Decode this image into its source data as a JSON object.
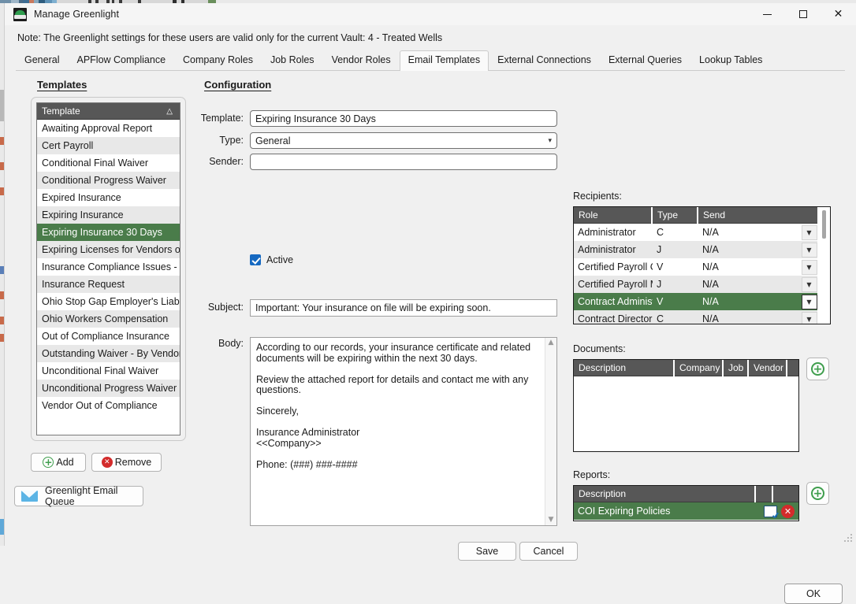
{
  "window": {
    "title": "Manage Greenlight",
    "app_icon": "greenlight-app-icon",
    "minimize": "—",
    "maximize": "□",
    "close": "✕"
  },
  "note": "Note:  The Greenlight settings for these users are valid only for the current Vault: 4 - Treated Wells",
  "tabs": [
    {
      "label": "General",
      "active": false
    },
    {
      "label": "APFlow Compliance",
      "active": false
    },
    {
      "label": "Company Roles",
      "active": false
    },
    {
      "label": "Job Roles",
      "active": false
    },
    {
      "label": "Vendor Roles",
      "active": false
    },
    {
      "label": "Email Templates",
      "active": true
    },
    {
      "label": "External Connections",
      "active": false
    },
    {
      "label": "External Queries",
      "active": false
    },
    {
      "label": "Lookup Tables",
      "active": false
    }
  ],
  "templates": {
    "heading": "Templates",
    "column_header": "Template",
    "sort_indicator": "△",
    "items": [
      {
        "label": "Awaiting Approval Report",
        "selected": false
      },
      {
        "label": "Cert Payroll",
        "selected": false
      },
      {
        "label": "Conditional Final Waiver",
        "selected": false
      },
      {
        "label": "Conditional Progress Waiver",
        "selected": false
      },
      {
        "label": "Expired Insurance",
        "selected": false
      },
      {
        "label": "Expiring Insurance",
        "selected": false
      },
      {
        "label": "Expiring Insurance 30 Days",
        "selected": true
      },
      {
        "label": "Expiring Licenses for Vendors on th...",
        "selected": false
      },
      {
        "label": "Insurance Compliance Issues - Job",
        "selected": false
      },
      {
        "label": "Insurance Request",
        "selected": false
      },
      {
        "label": "Ohio Stop Gap Employer's Liability",
        "selected": false
      },
      {
        "label": "Ohio Workers Compensation",
        "selected": false
      },
      {
        "label": "Out of Compliance Insurance",
        "selected": false
      },
      {
        "label": "Outstanding Waiver - By Vendor By...",
        "selected": false
      },
      {
        "label": "Unconditional Final Waiver",
        "selected": false
      },
      {
        "label": "Unconditional Progress Waiver",
        "selected": false
      },
      {
        "label": "Vendor Out of Compliance",
        "selected": false
      }
    ],
    "add_label": "Add",
    "remove_label": "Remove",
    "queue_label": "Greenlight Email Queue"
  },
  "configuration": {
    "heading": "Configuration",
    "template_label": "Template:",
    "template_value": "Expiring Insurance 30 Days",
    "type_label": "Type:",
    "type_value": "General",
    "type_chevron": "⌄",
    "sender_label": "Sender:",
    "sender_value": "",
    "active_label": "Active",
    "active_checked": true,
    "subject_label": "Subject:",
    "subject_value": "Important: Your insurance on file will be expiring soon.",
    "body_label": "Body:",
    "body_value": "According to our records, your insurance certificate and related documents will be expiring within the next 30 days.\n\nReview the attached report for details and contact me with any questions.\n\nSincerely,\n\nInsurance Administrator\n<<Company>>\n\nPhone: (###) ###-####",
    "scroll_up": "▲",
    "scroll_down": "▼",
    "save_label": "Save",
    "cancel_label": "Cancel"
  },
  "recipients": {
    "label": "Recipients:",
    "columns": [
      "Role",
      "Type",
      "Send"
    ],
    "dropdown_glyph": "▼",
    "rows": [
      {
        "role": "Administrator",
        "type": "C",
        "send": "N/A",
        "selected": false
      },
      {
        "role": "Administrator",
        "type": "J",
        "send": "N/A",
        "selected": false
      },
      {
        "role": "Certified Payroll C...",
        "type": "V",
        "send": "N/A",
        "selected": false
      },
      {
        "role": "Certified Payroll M...",
        "type": "J",
        "send": "N/A",
        "selected": false
      },
      {
        "role": "Contract Administ...",
        "type": "V",
        "send": "N/A",
        "selected": true
      },
      {
        "role": "Contract Director",
        "type": "C",
        "send": "N/A",
        "selected": false
      }
    ]
  },
  "documents": {
    "label": "Documents:",
    "columns": [
      "Description",
      "Company",
      "Job",
      "Vendor",
      ""
    ],
    "rows": [],
    "add_icon": "plus-circle-icon"
  },
  "reports": {
    "label": "Reports:",
    "columns": [
      "Description",
      "",
      ""
    ],
    "rows": [
      {
        "description": "COI Expiring Policies",
        "selected": true,
        "edit_icon": "edit-icon",
        "delete_icon": "delete-icon"
      }
    ],
    "add_icon": "plus-circle-icon"
  },
  "footer": {
    "ok_label": "OK"
  },
  "colors": {
    "selection_green": "#4a7c4a",
    "grid_header": "#575757",
    "accent_blue": "#1669c1",
    "add_green": "#3f9e4d",
    "delete_red": "#d32b2b",
    "window_bg": "#f0f0f0"
  }
}
